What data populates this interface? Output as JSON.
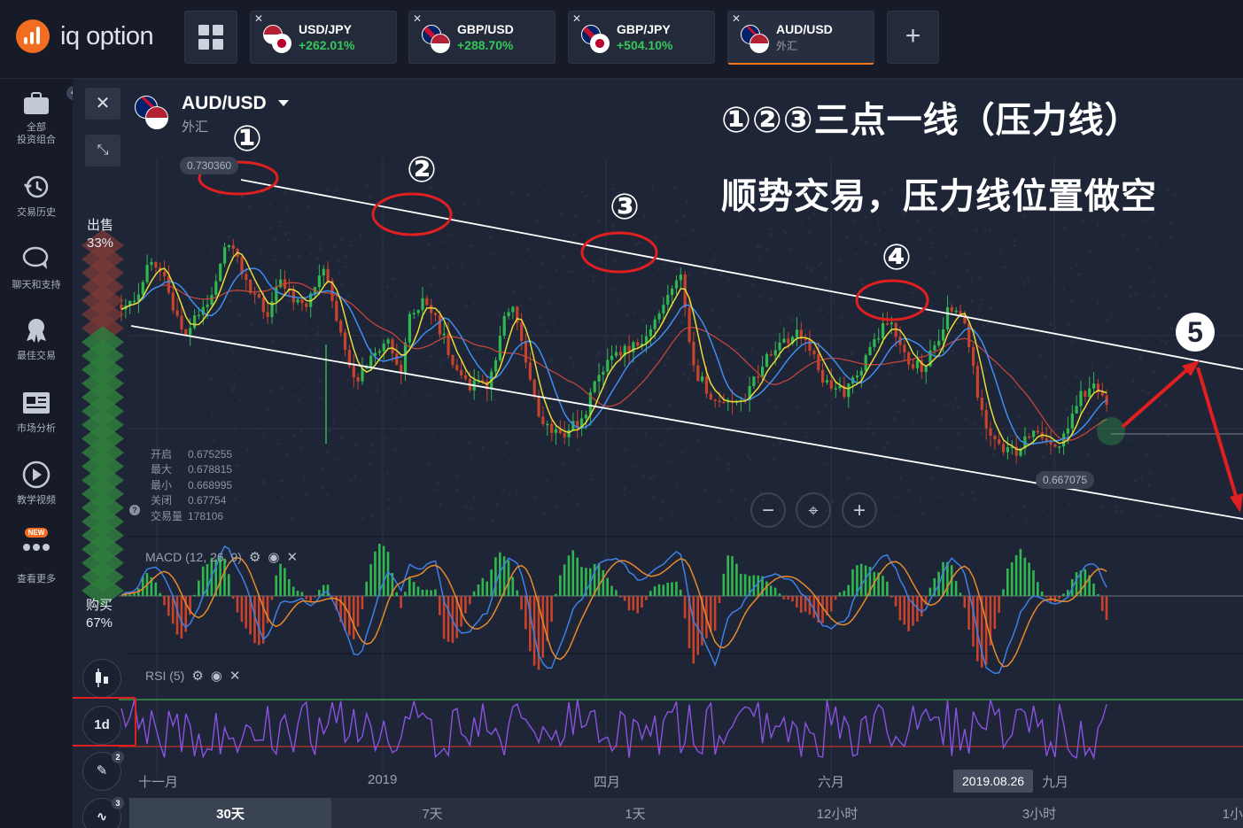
{
  "app": {
    "logo_text": "iq option"
  },
  "tabs": [
    {
      "name": "USD/JPY",
      "sub": "+262.01%"
    },
    {
      "name": "GBP/USD",
      "sub": "+288.70%"
    },
    {
      "name": "GBP/JPY",
      "sub": "+504.10%"
    },
    {
      "name": "AUD/USD",
      "sub": "外汇"
    }
  ],
  "sidebar": {
    "portfolio_badge": "4",
    "items": [
      {
        "label": "全部\n投资组合",
        "icon": "briefcase-icon"
      },
      {
        "label": "交易历史",
        "icon": "history-icon"
      },
      {
        "label": "聊天和支持",
        "icon": "chat-icon"
      },
      {
        "label": "最佳交易",
        "icon": "medal-icon"
      },
      {
        "label": "市场分析",
        "icon": "newspaper-icon"
      },
      {
        "label": "教学视频",
        "icon": "play-icon"
      },
      {
        "label": "查看更多",
        "icon": "more-icon",
        "badge": "NEW"
      }
    ]
  },
  "chart_header": {
    "pair": "AUD/USD",
    "category": "外汇"
  },
  "sentiment": {
    "sell_label": "出售",
    "sell_pct": "33%",
    "buy_label": "购买",
    "buy_pct": "67%"
  },
  "ohlc": {
    "open_label": "开启",
    "open": "0.675255",
    "high_label": "最大",
    "high": "0.678815",
    "low_label": "最小",
    "low": "0.668995",
    "close_label": "关闭",
    "close": "0.67754",
    "volume_label": "交易量",
    "volume": "178106"
  },
  "price_tags": {
    "high_tag": "0.730360",
    "current_tag": "0.667075"
  },
  "annotations": {
    "line1": "①②③三点一线（压力线）",
    "line2": "顺势交易，压力线位置做空",
    "points": [
      "①",
      "②",
      "③",
      "④"
    ],
    "point5": "5"
  },
  "indicators": {
    "macd": "MACD (12, 26, 9)",
    "rsi": "RSI (5)"
  },
  "x_axis": {
    "labels": [
      "十一月",
      "2019",
      "四月",
      "六月",
      "九月"
    ],
    "hover_date": "2019.08.26"
  },
  "ranges": [
    "30天",
    "7天",
    "1天",
    "12小时",
    "3小时",
    "1小"
  ],
  "tools": {
    "timeframe": "1d",
    "draw_badge": "2",
    "indicator_badge": "3"
  },
  "colors": {
    "accent": "#f36d21",
    "up": "#2fb84f",
    "down": "#c9432c",
    "annotation_red": "#e02020",
    "rsi": "#8a52e0",
    "macd": "#3f7fe6",
    "signal": "#e88a2a"
  }
}
